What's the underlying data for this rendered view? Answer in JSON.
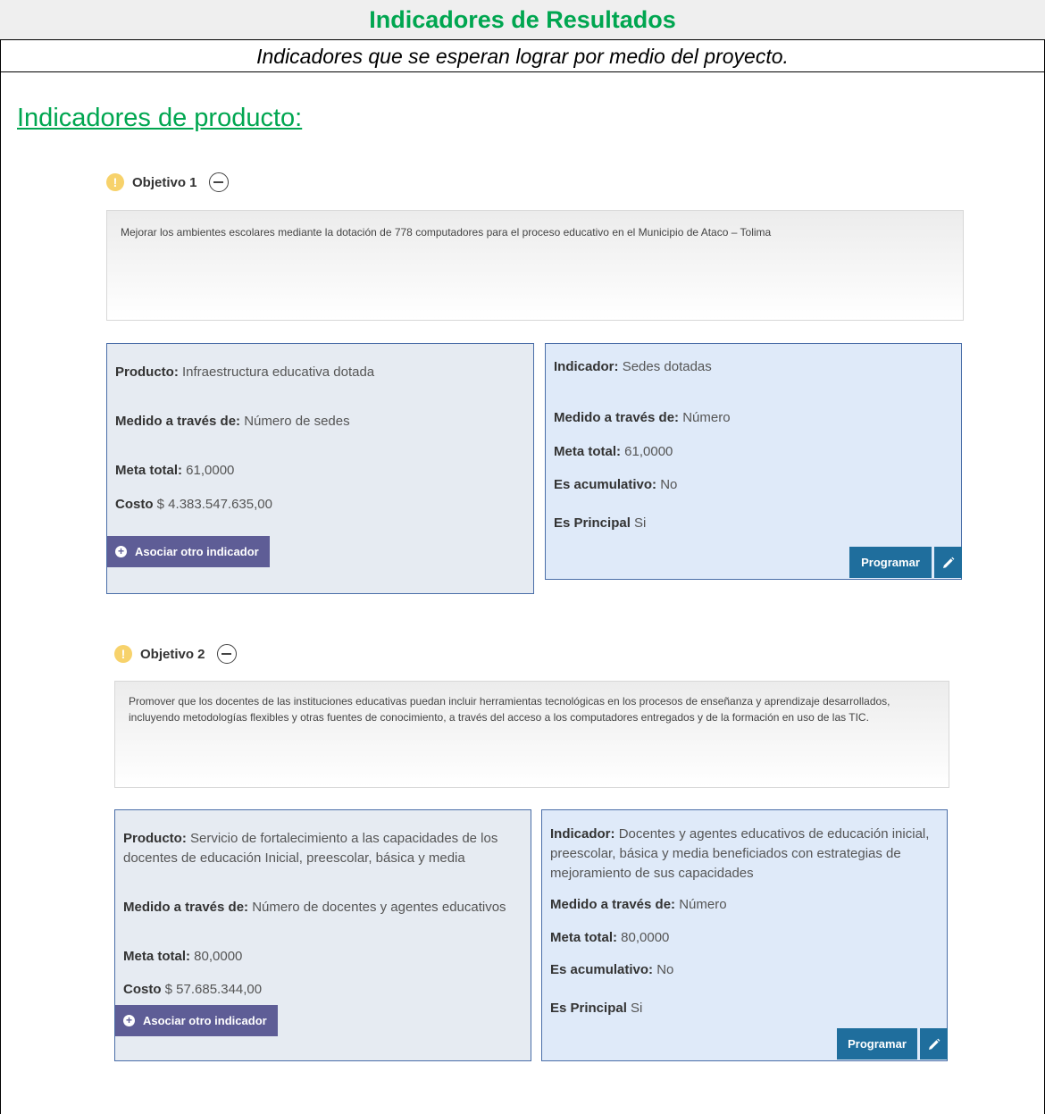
{
  "header": {
    "title": "Indicadores de Resultados",
    "subtitle": "Indicadores que se esperan lograr por medio del proyecto."
  },
  "section_title": "Indicadores de producto:",
  "objectives": [
    {
      "label": "Objetivo 1",
      "description": "Mejorar los ambientes escolares mediante la dotación de 778 computadores para el proceso educativo en el Municipio de Ataco – Tolima",
      "product": {
        "producto_label": "Producto:",
        "producto_value": "Infraestructura educativa dotada",
        "medido_label": "Medido a través de:",
        "medido_value": "Número de sedes",
        "meta_label": "Meta total:",
        "meta_value": "61,0000",
        "costo_label": "Costo",
        "costo_value": "$ 4.383.547.635,00",
        "assoc_button": "Asociar otro indicador"
      },
      "indicator": {
        "indicador_label": "Indicador:",
        "indicador_value": "Sedes dotadas",
        "medido_label": "Medido a través de:",
        "medido_value": "Número",
        "meta_label": "Meta total:",
        "meta_value": "61,0000",
        "acum_label": "Es acumulativo:",
        "acum_value": "No",
        "principal_label": "Es Principal",
        "principal_value": "Si",
        "program_button": "Programar"
      }
    },
    {
      "label": "Objetivo 2",
      "description": "Promover que los docentes de las instituciones educativas puedan incluir herramientas tecnológicas en los procesos de enseñanza y aprendizaje desarrollados, incluyendo metodologías flexibles y otras fuentes de conocimiento, a través del acceso a los computadores entregados y de la formación en uso de las TIC.",
      "product": {
        "producto_label": "Producto:",
        "producto_value": "Servicio de fortalecimiento a las capacidades de los docentes de educación Inicial, preescolar, básica y media",
        "medido_label": "Medido a través de:",
        "medido_value": "Número de docentes y agentes educativos",
        "meta_label": "Meta total:",
        "meta_value": "80,0000",
        "costo_label": "Costo",
        "costo_value": "$ 57.685.344,00",
        "assoc_button": "Asociar otro indicador"
      },
      "indicator": {
        "indicador_label": "Indicador:",
        "indicador_value": "Docentes y agentes educativos de educación inicial, preescolar, básica y media beneficiados con estrategias de mejoramiento de sus capacidades",
        "medido_label": "Medido a través de:",
        "medido_value": "Número",
        "meta_label": "Meta total:",
        "meta_value": "80,0000",
        "acum_label": "Es acumulativo:",
        "acum_value": "No",
        "principal_label": "Es Principal",
        "principal_value": "Si",
        "program_button": "Programar"
      }
    }
  ],
  "icons": {
    "warning": "warning-icon",
    "collapse": "minus-circle-icon",
    "add": "plus-circle-icon",
    "edit": "pencil-icon"
  },
  "colors": {
    "title_green": "#00a650",
    "assoc_button": "#5e5d96",
    "program_button": "#1f6e9d",
    "card_border": "#4a6ea8"
  }
}
